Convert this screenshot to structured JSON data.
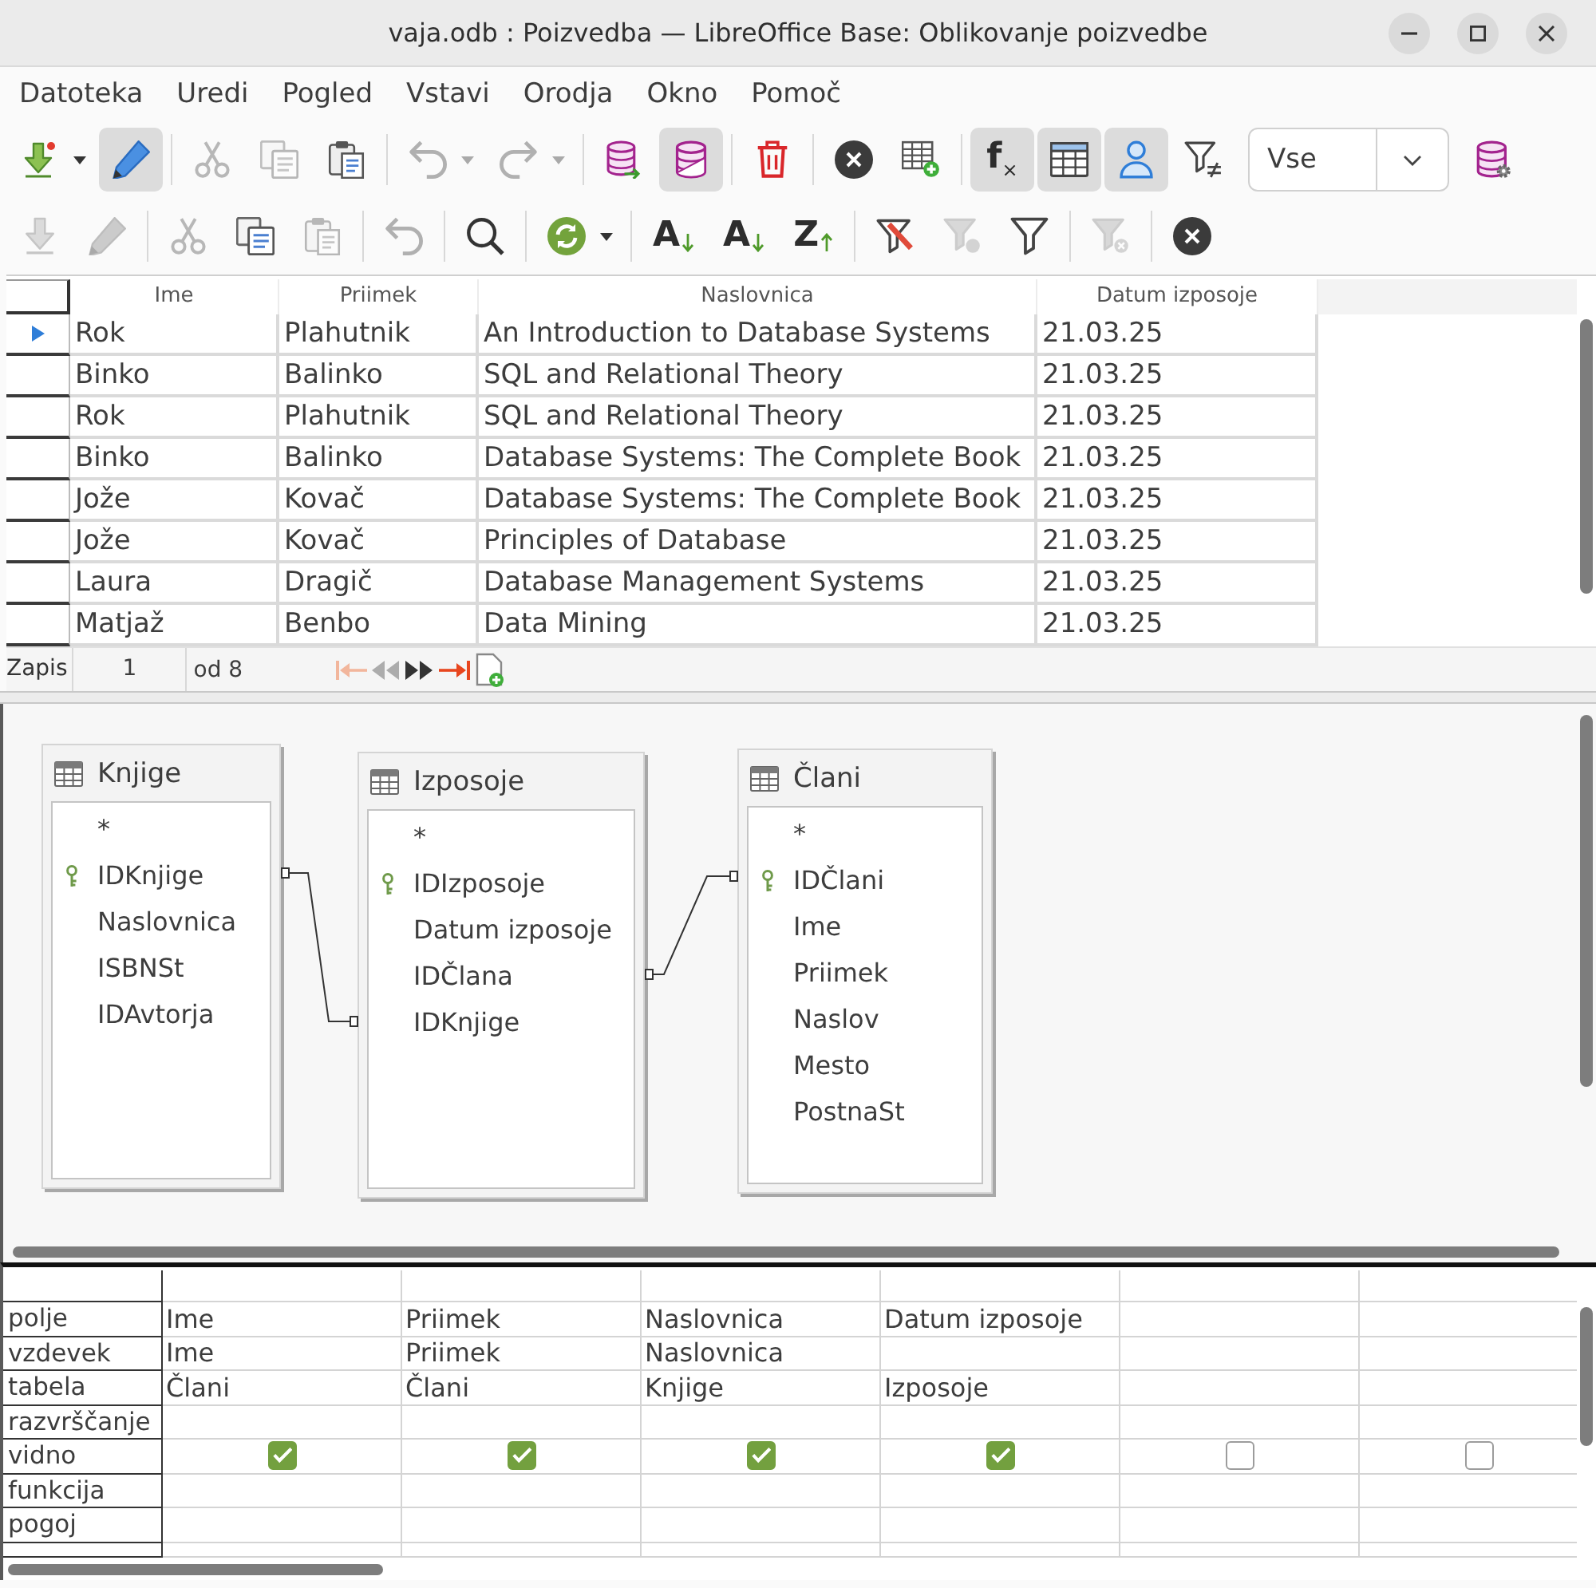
{
  "window": {
    "title": "vaja.odb : Poizvedba — LibreOffice Base: Oblikovanje poizvedbe"
  },
  "menu": [
    "Datoteka",
    "Uredi",
    "Pogled",
    "Vstavi",
    "Orodja",
    "Okno",
    "Pomoč"
  ],
  "toolbar_1": [
    [
      {
        "kind": "icon",
        "pressed": false,
        "disabled": false,
        "dropdown": true
      },
      {
        "kind": "icon",
        "pressed": true,
        "disabled": false
      }
    ],
    [
      {
        "kind": "icon",
        "pressed": false,
        "disabled": true
      },
      {
        "kind": "icon",
        "pressed": false,
        "disabled": true
      },
      {
        "kind": "icon",
        "pressed": false,
        "disabled": false
      }
    ],
    [
      {
        "kind": "icon",
        "pressed": false,
        "disabled": true,
        "dropdown": true
      },
      {
        "kind": "icon",
        "pressed": false,
        "disabled": true,
        "dropdown": true
      }
    ],
    [
      {
        "kind": "icon",
        "pressed": false,
        "disabled": false
      },
      {
        "kind": "icon",
        "pressed": true,
        "disabled": false
      }
    ],
    [
      {
        "kind": "icon",
        "pressed": false,
        "disabled": false
      }
    ],
    [
      {
        "kind": "icon",
        "pressed": false,
        "disabled": false
      },
      {
        "kind": "icon",
        "pressed": false,
        "disabled": false
      }
    ],
    [
      {
        "kind": "glyph",
        "glyph": "f$_{×}$",
        "pressed": true,
        "disabled": false
      },
      {
        "kind": "icon",
        "pressed": true,
        "disabled": false
      },
      {
        "kind": "icon",
        "pressed": true,
        "disabled": false
      },
      {
        "kind": "icon",
        "pressed": false,
        "disabled": false
      },
      {
        "kind": "combo",
        "value": "Vse",
        "pressed": false,
        "disabled": false
      },
      {
        "kind": "icon",
        "pressed": false,
        "disabled": false
      }
    ]
  ],
  "toolbar_2": [
    [
      {
        "kind": "icon",
        "pressed": false,
        "disabled": true
      },
      {
        "kind": "icon",
        "pressed": false,
        "disabled": true
      }
    ],
    [
      {
        "kind": "icon",
        "pressed": false,
        "disabled": true
      },
      {
        "kind": "icon",
        "pressed": false,
        "disabled": false
      },
      {
        "kind": "icon",
        "pressed": false,
        "disabled": true
      }
    ],
    [
      {
        "kind": "icon",
        "pressed": false,
        "disabled": true
      }
    ],
    [
      {
        "kind": "icon",
        "pressed": false,
        "disabled": false
      }
    ],
    [
      {
        "kind": "icon",
        "pressed": false,
        "disabled": false,
        "dropdown": true
      }
    ],
    [
      {
        "kind": "glyph",
        "glyph": "A",
        "pressed": false,
        "disabled": false
      },
      {
        "kind": "glyph",
        "glyph": "A",
        "pressed": false,
        "disabled": false
      },
      {
        "kind": "glyph",
        "glyph": "Z",
        "pressed": false,
        "disabled": false
      }
    ],
    [
      {
        "kind": "icon",
        "pressed": false,
        "disabled": false
      },
      {
        "kind": "icon",
        "pressed": false,
        "disabled": true
      },
      {
        "kind": "icon",
        "pressed": false,
        "disabled": false
      }
    ],
    [
      {
        "kind": "icon",
        "pressed": false,
        "disabled": true
      }
    ],
    [
      {
        "kind": "icon",
        "pressed": false,
        "disabled": false
      }
    ]
  ],
  "result_grid": {
    "columns": [
      "Ime",
      "Priimek",
      "Naslovnica",
      "Datum izposoje"
    ],
    "rows": [
      {
        "current": true,
        "cells": [
          "Rok",
          "Plahutnik",
          "An Introduction to Database Systems",
          "21.03.25"
        ]
      },
      {
        "current": false,
        "cells": [
          "Binko",
          "Balinko",
          "SQL and Relational Theory",
          "21.03.25"
        ]
      },
      {
        "current": false,
        "cells": [
          "Rok",
          "Plahutnik",
          "SQL and Relational Theory",
          "21.03.25"
        ]
      },
      {
        "current": false,
        "cells": [
          "Binko",
          "Balinko",
          "Database Systems: The Complete Book",
          "21.03.25"
        ]
      },
      {
        "current": false,
        "cells": [
          "Jože",
          "Kovač",
          "Database Systems: The Complete Book",
          "21.03.25"
        ]
      },
      {
        "current": false,
        "cells": [
          "Jože",
          "Kovač",
          "Principles of Database",
          "21.03.25"
        ]
      },
      {
        "current": false,
        "cells": [
          "Laura",
          "Dragič",
          "Database Management Systems",
          "21.03.25"
        ]
      },
      {
        "current": false,
        "cells": [
          "Matjaž",
          "Benbo",
          "Data Mining",
          "21.03.25"
        ]
      }
    ]
  },
  "record_bar": {
    "label": "Zapis",
    "record": "1",
    "total": "od 8",
    "buttons": [
      {
        "disabled": true
      },
      {
        "disabled": true
      },
      {
        "disabled": false
      },
      {
        "disabled": false
      },
      {
        "disabled": false
      }
    ]
  },
  "tables": [
    {
      "name": "Knjige",
      "fields": [
        {
          "name": "*",
          "key": false
        },
        {
          "name": "IDKnjige",
          "key": true
        },
        {
          "name": "Naslovnica",
          "key": false
        },
        {
          "name": "ISBNSt",
          "key": false
        },
        {
          "name": "IDAvtorja",
          "key": false
        }
      ]
    },
    {
      "name": "Izposoje",
      "fields": [
        {
          "name": "*",
          "key": false
        },
        {
          "name": "IDIzposoje",
          "key": true
        },
        {
          "name": "Datum izposoje",
          "key": false
        },
        {
          "name": "IDČlana",
          "key": false
        },
        {
          "name": "IDKnjige",
          "key": false
        }
      ]
    },
    {
      "name": "Člani",
      "fields": [
        {
          "name": "*",
          "key": false
        },
        {
          "name": "IDČlani",
          "key": true
        },
        {
          "name": "Ime",
          "key": false
        },
        {
          "name": "Priimek",
          "key": false
        },
        {
          "name": "Naslov",
          "key": false
        },
        {
          "name": "Mesto",
          "key": false
        },
        {
          "name": "PostnaSt",
          "key": false
        }
      ]
    }
  ],
  "query_design": {
    "rows": [
      {
        "label": "polje",
        "kind": "text"
      },
      {
        "label": "vzdevek",
        "kind": "text"
      },
      {
        "label": "tabela",
        "kind": "text"
      },
      {
        "label": "razvrščanje",
        "kind": "text"
      },
      {
        "label": "vidno",
        "kind": "checkbox"
      },
      {
        "label": "funkcija",
        "kind": "text"
      },
      {
        "label": "pogoj",
        "kind": "text"
      }
    ],
    "columns": [
      {
        "field": "Ime",
        "alias": "Ime",
        "table": "Člani",
        "visible": true
      },
      {
        "field": "Priimek",
        "alias": "Priimek",
        "table": "Člani",
        "visible": true
      },
      {
        "field": "Naslovnica",
        "alias": "Naslovnica",
        "table": "Knjige",
        "visible": true
      },
      {
        "field": "Datum izposoje",
        "table": "Izposoje",
        "visible": true
      },
      {
        "visible": false
      },
      {
        "visible": false
      }
    ]
  }
}
